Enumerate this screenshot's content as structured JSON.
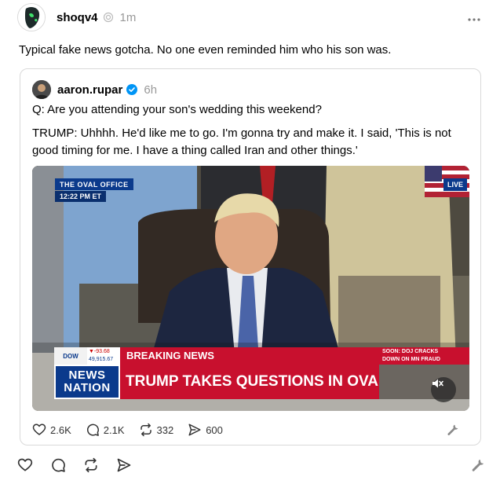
{
  "post": {
    "username": "shoqv4",
    "time": "1m",
    "more_icon": "more-horizontal-icon",
    "text": "Typical fake news gotcha. No one even reminded him who his son was."
  },
  "quote": {
    "username": "aaron.rupar",
    "time": "6h",
    "verified_color": "#0095f6",
    "line1": "Q: Are you attending your son's wedding this weekend?",
    "line2": "TRUMP: Uhhhh. He'd like me to go. I'm gonna try and make it. I said, 'This is not good timing for me. I have a thing called Iran and other things.'",
    "video": {
      "location_tag": "THE OVAL OFFICE",
      "clock": "12:22 PM ET",
      "live": "LIVE",
      "dow_label": "DOW",
      "dow_change": "▼-93.68",
      "dow_value": "49,915.67",
      "breaking": "BREAKING NEWS",
      "network_line1": "NEWS",
      "network_line2": "NATION",
      "headline": "TRUMP TAKES QUESTIONS IN OVAL OFFICE",
      "soon_line1": "SOON: DOJ CRACKS",
      "soon_line2": "DOWN ON MN FRAUD",
      "accent_red": "#c8102e",
      "accent_blue": "#0b3a8c"
    },
    "stats": {
      "likes": "2.6K",
      "replies": "2.1K",
      "reposts": "332",
      "shares": "600"
    }
  }
}
